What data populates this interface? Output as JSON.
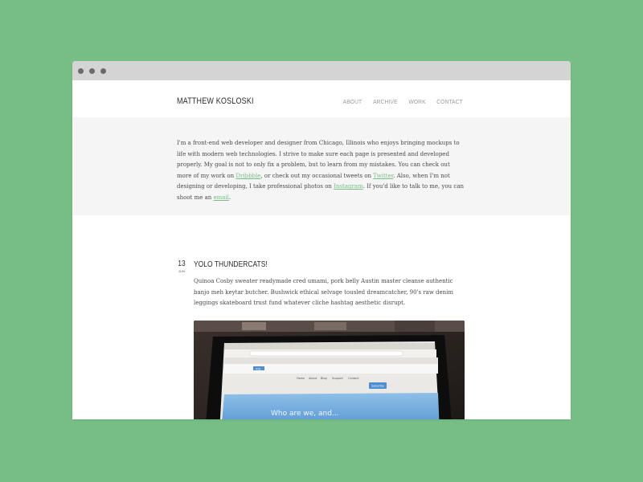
{
  "site": {
    "title": "MATTHEW KOSLOSKI",
    "nav": [
      "ABOUT",
      "ARCHIVE",
      "WORK",
      "CONTACT"
    ]
  },
  "intro": {
    "text_1": "I'm a front-end web developer and designer from Chicago, Illinois who enjoys bringing mockups to life with modern web technologies. I strive to make sure each page is presented and developed properly. My goal is not to only fix a problem, but to learn from my mistakes. You can check out more of my work on ",
    "link_dribbble": "Dribbble",
    "text_2": ", or check out my occasional tweets on ",
    "link_twitter": "Twitter",
    "text_3": ". Also, when I'm not designing or developing, I take professional photos on ",
    "link_instagram": "Instagram",
    "text_4": ". If you'd like to talk to me, you can shoot me an ",
    "link_email": "email",
    "text_5": "."
  },
  "post": {
    "day": "13",
    "month": "JUN",
    "title": "YOLO THUNDERCATS!",
    "body": "Quinoa Cosby sweater readymade cred umami, pork belly Austin master cleanse authentic banjo meh keytar butcher. Bushwick ethical selvage tousled dreamcatcher, 90's raw denim leggings skateboard trust fund whatever cliche hashtag aesthetic disrupt.",
    "image": {
      "nav": [
        "Home",
        "About",
        "Blog",
        "Support",
        "Contact"
      ],
      "button": "Subscribe",
      "headline": "Who are we, and..."
    }
  },
  "colors": {
    "background": "#76be85",
    "link": "#76be85",
    "intro_bg": "#f5f5f5"
  }
}
